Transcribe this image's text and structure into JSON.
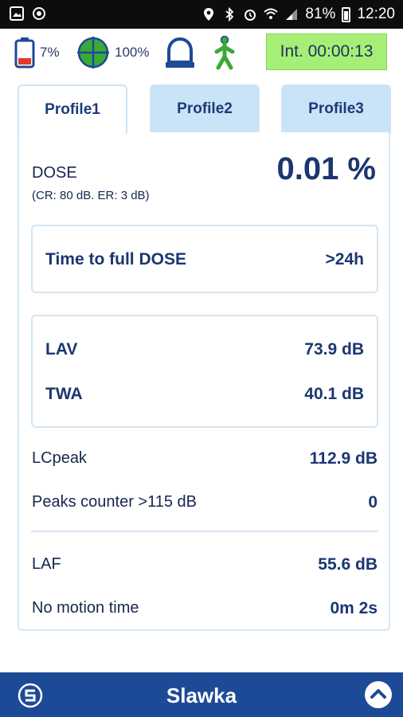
{
  "status_bar": {
    "battery_percent": "81%",
    "time": "12:20"
  },
  "indicators": {
    "battery_text": "7%",
    "gps_text": "100%",
    "interval_text": "Int. 00:00:13",
    "colors": {
      "battery_low": "#e03a2e",
      "gps": "#3aaa35",
      "alarm": "#1d4a97",
      "motion": "#3aaa35",
      "interval_bg": "#a6ef76"
    },
    "icons": [
      "battery-low-icon",
      "gps-target-icon",
      "alarm-bell-icon",
      "walking-person-icon"
    ]
  },
  "tabs": [
    {
      "label": "Profile1",
      "active": true
    },
    {
      "label": "Profile2",
      "active": false
    },
    {
      "label": "Profile3",
      "active": false
    }
  ],
  "dose": {
    "label": "DOSE",
    "sub": "(CR: 80 dB. ER: 3 dB)",
    "value": "0.01 %"
  },
  "time_to_full": {
    "label": "Time to full DOSE",
    "value": ">24h"
  },
  "levels": {
    "lav_label": "LAV",
    "lav_value": "73.9 dB",
    "twa_label": "TWA",
    "twa_value": "40.1 dB"
  },
  "peak": {
    "lcpeak_label": "LCpeak",
    "lcpeak_value": "112.9 dB",
    "counter_label": "Peaks counter >115 dB",
    "counter_value": "0"
  },
  "extra": {
    "laf_label": "LAF",
    "laf_value": "55.6 dB",
    "motion_label": "No motion time",
    "motion_value": "0m 2s"
  },
  "bottom_bar": {
    "title": "Slawka",
    "color": "#1d4a97"
  }
}
